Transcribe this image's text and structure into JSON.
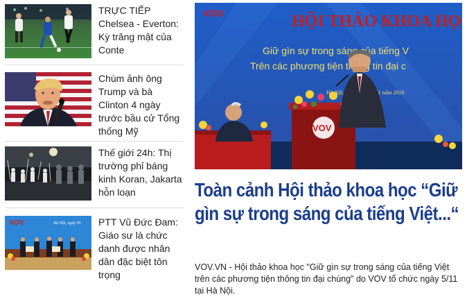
{
  "side_news": [
    {
      "title": "TRỰC TIẾP Chelsea - Everton: Kỳ trăng mật của Conte"
    },
    {
      "title": "Chùm ảnh ông Trump và bà Clinton 4 ngày trước bầu cử Tổng thống Mỹ"
    },
    {
      "title": "Thế giới 24h: Thị trường phỉ báng kinh Koran, Jakarta hỗn loạn"
    },
    {
      "title": "PTT Vũ Đức Đam: Giáo sư là chức danh được nhân dân đặc biệt tôn trọng"
    }
  ],
  "featured": {
    "headline": "Toàn cảnh Hội thảo khoa học “Giữ gìn sự trong sáng của tiếng Việt...“",
    "summary": "VOV.VN - Hội thảo khoa học \"Giữ gìn sự trong sáng của tiếng Việt trên các phương tiện thông tin đại chúng\" do VOV tổ chức ngày 5/11 tại Hà Nội.",
    "image_text": {
      "logo": "VOV",
      "banner_title": "HỘI THẢO KHOA HỌC",
      "banner_line1": "Giữ gìn sự trong sáng của tiếng V",
      "banner_line2": "Trên các phương tiện thông tin đại c",
      "banner_date": "Hà Nội, ngày 5 tháng 11 năm 2016",
      "podium_logo": "VOV"
    }
  },
  "thumb_text": {
    "ceremony_logo": "VOV",
    "ceremony_date": "Hà Nội, ngày 05"
  }
}
